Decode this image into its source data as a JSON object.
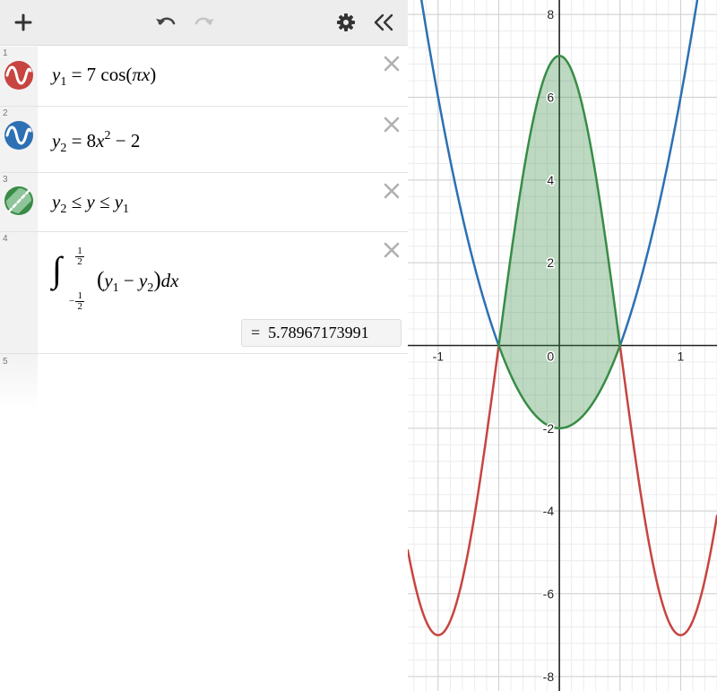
{
  "toolbar": {
    "add_icon": "plus-icon",
    "undo_icon": "undo-icon",
    "redo_icon": "redo-icon",
    "settings_icon": "gear-icon",
    "collapse_icon": "double-chevron-left-icon"
  },
  "expressions": [
    {
      "number": "1",
      "color": "#c74440",
      "icon": "wave-icon",
      "lhs_var": "y",
      "lhs_sub": "1",
      "equals": "=",
      "coef": "7",
      "func": "cos",
      "arg": "πx"
    },
    {
      "number": "2",
      "color": "#2d70b3",
      "icon": "wave-icon",
      "lhs_var": "y",
      "lhs_sub": "2",
      "equals": "=",
      "coef": "8",
      "var": "x",
      "exp": "2",
      "minus": "− 2"
    },
    {
      "number": "3",
      "color": "#388c46",
      "icon": "region-icon",
      "a_var": "y",
      "a_sub": "2",
      "le1": "≤",
      "mid": "y",
      "le2": "≤",
      "b_var": "y",
      "b_sub": "1"
    },
    {
      "number": "4",
      "integral_sign": "∫",
      "upper_num": "1",
      "upper_den": "2",
      "lower_sign": "−",
      "lower_num": "1",
      "lower_den": "2",
      "left_paren": "(",
      "t1_var": "y",
      "t1_sub": "1",
      "op": "−",
      "t2_var": "y",
      "t2_sub": "2",
      "right_paren": ")",
      "dx": "dx",
      "result_eq": "=",
      "result": "5.78967173991"
    },
    {
      "number": "5"
    }
  ],
  "graph": {
    "x_range": [
      -1.25,
      1.3
    ],
    "y_range": [
      -8.35,
      8.35
    ],
    "x_ticks": [
      "-1",
      "0",
      "1"
    ],
    "y_ticks": [
      "8",
      "6",
      "4",
      "2",
      "-2",
      "-4",
      "-6",
      "-8"
    ],
    "minor_step": 0.1,
    "major_x_step": 0.5,
    "major_y_step": 2,
    "grid": true,
    "curve1_color": "#c74440",
    "curve2_color": "#2d70b3",
    "region_color": "#388c46"
  }
}
